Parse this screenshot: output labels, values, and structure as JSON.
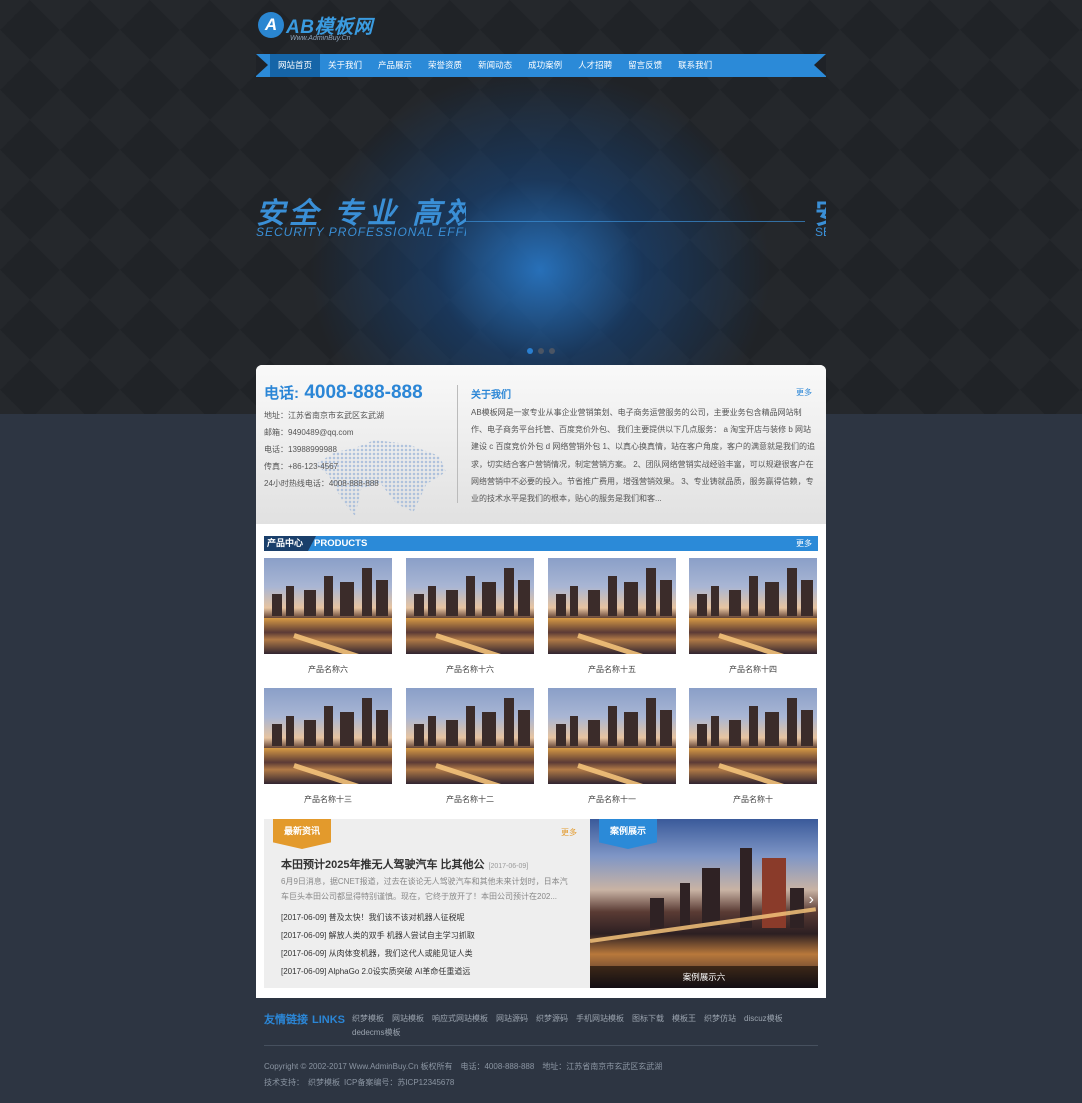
{
  "logo": {
    "mark": "A",
    "title": "AB模板网",
    "subtitle": "Www.AdminBuy.Cn"
  },
  "nav": [
    {
      "label": "网站首页",
      "active": true
    },
    {
      "label": "关于我们"
    },
    {
      "label": "产品展示"
    },
    {
      "label": "荣誉资质"
    },
    {
      "label": "新闻动态"
    },
    {
      "label": "成功案例"
    },
    {
      "label": "人才招聘"
    },
    {
      "label": "留言反馈"
    },
    {
      "label": "联系我们"
    }
  ],
  "banner": {
    "slogan_cn": "安全 专业 高效",
    "slogan_en": "SECURITY PROFESSIONAL EFFICIENT",
    "slogan_edge_cn": "安",
    "slogan_edge_en": "SE",
    "slide_count": 3,
    "active_slide": 1
  },
  "contact": {
    "phone_label": "电话:",
    "phone_number": "4008-888-888",
    "address": "地址：江苏省南京市玄武区玄武湖",
    "email": "邮箱：9490489@qq.com",
    "tel": "电话：13988999988",
    "fax": "传真：+86-123-4567",
    "hotline": "24小时热线电话：4008-888-888"
  },
  "about": {
    "title": "关于我们",
    "more": "更多",
    "text": "AB模板网是一家专业从事企业营销策划、电子商务运营服务的公司，主要业务包含精品网站制作、电子商务平台托管、百度竞价外包、 我们主要提供以下几点服务： a 淘宝开店与装修 b 网站建设 c 百度竞价外包 d 网络营销外包 1、以真心换真情，站在客户角度，客户的满意就是我们的追求，切实结合客户营销情况，制定营销方案。 2、团队网络营销实战经验丰富，可以规避很客户在网络营销中不必要的投入。节省推广费用，增强营销效果。 3、专业铸就品质，服务赢得信赖，专业的技术水平是我们的根本，贴心的服务是我们和客..."
  },
  "products": {
    "title_cn": "产品中心",
    "title_en": "PRODUCTS",
    "more": "更多",
    "items": [
      "产品名称六",
      "产品名称十六",
      "产品名称十五",
      "产品名称十四",
      "产品名称十三",
      "产品名称十二",
      "产品名称十一",
      "产品名称十"
    ]
  },
  "news": {
    "tab": "最新资讯",
    "more": "更多",
    "headline": "本田预计2025年推无人驾驶汽车 比其他公",
    "headline_date": "[2017-06-09]",
    "summary": "6月9日消息，据CNET报道，过去在谈论无人驾驶汽车和其他未来计划时，日本汽车巨头本田公司都显得特别谨慎。现在，它终于放开了！本田公司预计在202...",
    "list": [
      "[2017-06-09]   普及太快！我们该不该对机器人征税呢",
      "[2017-06-09]   解放人类的双手 机器人尝试自主学习抓取",
      "[2017-06-09]   从肉体变机器，我们这代人或能见证人类",
      "[2017-06-09]   AlphaGo 2.0设实质突破 AI革命任重道远"
    ]
  },
  "cases": {
    "tab": "案例展示",
    "caption": "案例展示六"
  },
  "links": {
    "title_cn": "友情链接",
    "title_en": "LINKS",
    "items": [
      "织梦模板",
      "网站模板",
      "响应式网站模板",
      "网站源码",
      "织梦源码",
      "手机网站模板",
      "图标下载",
      "模板王",
      "织梦仿站",
      "discuz模板",
      "dedecms模板"
    ]
  },
  "footer": {
    "copyright": "Copyright © 2002-2017 Www.AdminBuy.Cn 板权所有",
    "phone": "电话：4008-888-888",
    "address": "地址：江苏省南京市玄武区玄武湖",
    "tech_label": "技术支持：",
    "tech_link": "织梦模板",
    "icp": "ICP备案编号：苏ICP12345678"
  }
}
